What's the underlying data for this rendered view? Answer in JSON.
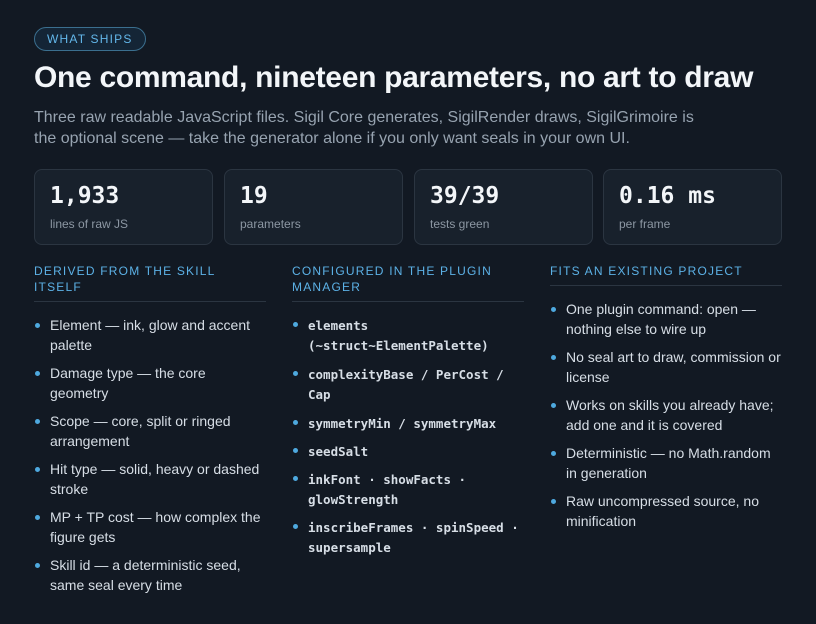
{
  "badge": "WHAT SHIPS",
  "title": "One command, nineteen parameters, no art to draw",
  "subtitle": "Three raw readable JavaScript files. Sigil Core generates, SigilRender draws, SigilGrimoire is the optional scene — take the generator alone if you only want seals in your own UI.",
  "stats": [
    {
      "value": "1,933",
      "label": "lines of raw JS"
    },
    {
      "value": "19",
      "label": "parameters"
    },
    {
      "value": "39/39",
      "label": "tests green"
    },
    {
      "value": "0.16 ms",
      "label": "per frame"
    }
  ],
  "columns": [
    {
      "heading": "DERIVED FROM THE SKILL ITSELF",
      "items": [
        "Element — ink, glow and accent palette",
        "Damage type — the core geometry",
        "Scope — core, split or ringed arrangement",
        "Hit type — solid, heavy or dashed stroke",
        "MP + TP cost — how complex the figure gets",
        "Skill id — a deterministic seed, same seal every time"
      ]
    },
    {
      "heading": "CONFIGURED IN THE PLUGIN MANAGER",
      "items": [
        "elements (~struct~ElementPalette)",
        "complexityBase / PerCost / Cap",
        "symmetryMin / symmetryMax",
        "seedSalt",
        "inkFont · showFacts · glowStrength",
        "inscribeFrames · spinSpeed · supersample"
      ]
    },
    {
      "heading": "FITS AN EXISTING PROJECT",
      "items": [
        "One plugin command: open — nothing else to wire up",
        "No seal art to draw, commission or license",
        "Works on skills you already have; add one and it is covered",
        "Deterministic — no Math.random in generation",
        "Raw uncompressed source, no minification"
      ]
    }
  ]
}
